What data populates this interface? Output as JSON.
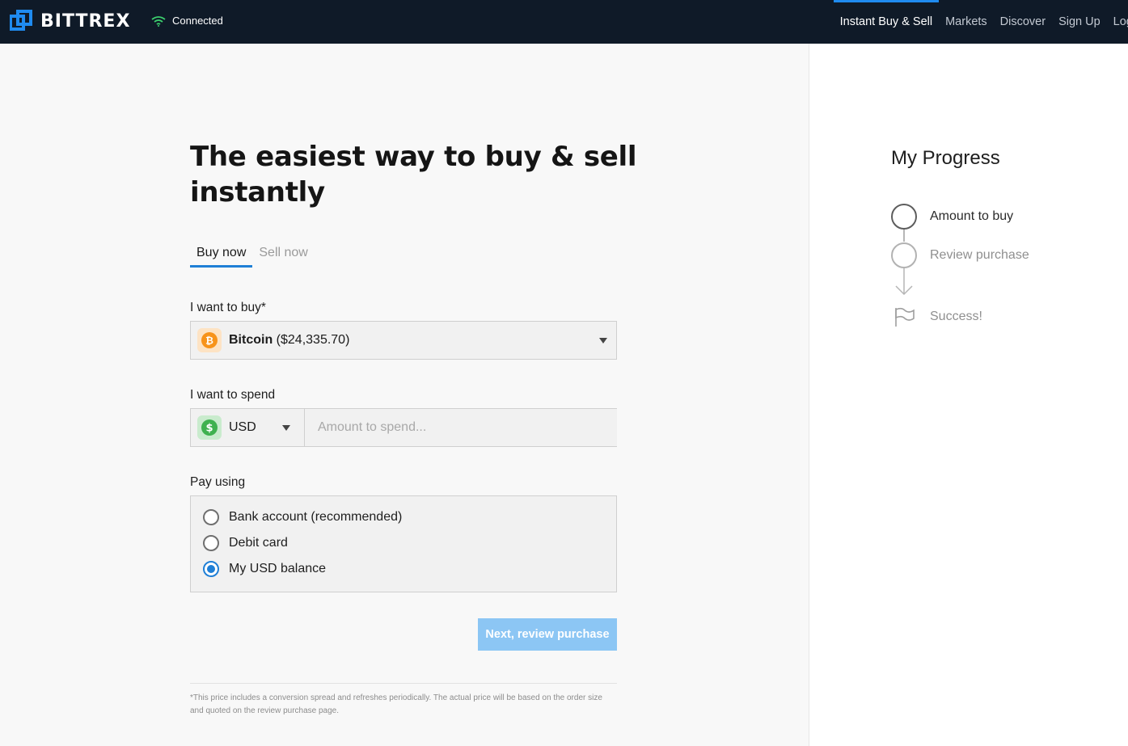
{
  "header": {
    "brand": "BITTREX",
    "connection_status": "Connected",
    "nav": [
      {
        "label": "Instant Buy & Sell",
        "active": true
      },
      {
        "label": "Markets",
        "active": false
      },
      {
        "label": "Discover",
        "active": false
      },
      {
        "label": "Sign Up",
        "active": false
      },
      {
        "label": "Log In",
        "active": false
      }
    ]
  },
  "main": {
    "headline": "The easiest way to buy & sell instantly",
    "tabs": [
      {
        "label": "Buy now",
        "active": true
      },
      {
        "label": "Sell now",
        "active": false
      }
    ],
    "buy": {
      "label": "I want to buy*",
      "asset_name": "Bitcoin",
      "asset_price": "($24,335.70)",
      "asset_icon": "bitcoin-icon"
    },
    "spend": {
      "label": "I want to spend",
      "currency": "USD",
      "currency_icon": "dollar-icon",
      "amount_value": "",
      "amount_placeholder": "Amount to spend..."
    },
    "pay": {
      "label": "Pay using",
      "options": [
        {
          "label": "Bank account (recommended)",
          "selected": false
        },
        {
          "label": "Debit card",
          "selected": false
        },
        {
          "label": "My USD balance",
          "selected": true
        }
      ]
    },
    "next_button": "Next, review purchase",
    "footnote": "*This price includes a conversion spread and refreshes periodically. The actual price will be based on the order size and quoted on the review purchase page."
  },
  "progress": {
    "title": "My Progress",
    "steps": [
      {
        "label": "Amount to buy",
        "state": "current"
      },
      {
        "label": "Review purchase",
        "state": "pending"
      },
      {
        "label": "Success!",
        "state": "pending"
      }
    ]
  },
  "colors": {
    "header_bg": "#0f1a28",
    "accent": "#1f7fd6",
    "button_disabled": "#8cc6f4",
    "bitcoin": "#f7931a",
    "usd": "#3fb14f"
  }
}
